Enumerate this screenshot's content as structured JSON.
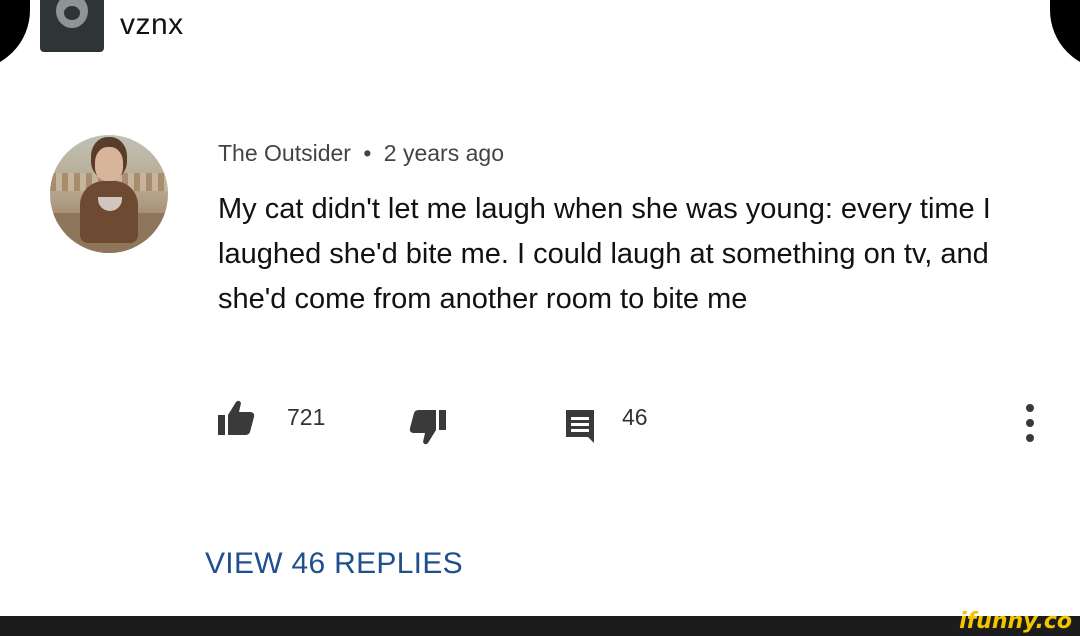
{
  "post": {
    "username": "vznx"
  },
  "comment": {
    "author": "The Outsider",
    "separator": "•",
    "time": "2 years ago",
    "text": "My cat didn't let me laugh when she was young: every time I laughed she'd bite me. I could laugh at something on tv, and she'd come from another room to bite me",
    "likes": "721",
    "replies_count": "46",
    "view_replies_label": "VIEW 46 REPLIES"
  },
  "icons": {
    "like": "thumbs-up-icon",
    "dislike": "thumbs-down-icon",
    "reply": "comment-icon",
    "more": "more-vertical-icon"
  },
  "colors": {
    "link": "#1f4f8d",
    "watermark": "#f3c400"
  },
  "watermark": {
    "text": "ifunny.co"
  }
}
